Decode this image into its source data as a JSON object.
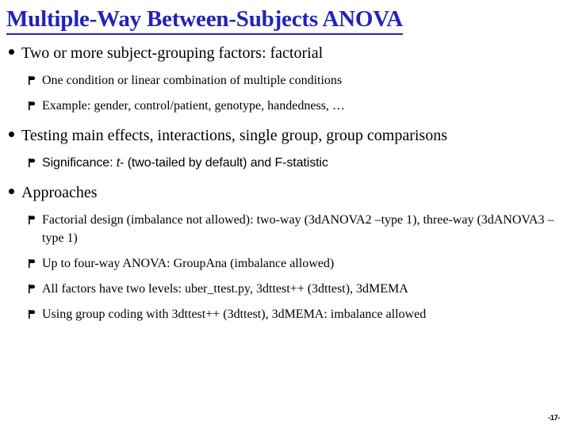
{
  "slide": {
    "title": "Multiple-Way Between-Subjects ANOVA",
    "page_number": "-17-",
    "title_color": "#2222BB",
    "background_color": "#FFFFFF",
    "text_color": "#000000",
    "bullet_markers": {
      "level1": "filled-circle-bullet",
      "level2": "wingdings-pennant-bullet"
    },
    "content": [
      {
        "level": 1,
        "text": "Two or more subject-grouping factors: factorial"
      },
      {
        "level": 2,
        "text": "One condition or linear combination of multiple conditions"
      },
      {
        "level": 2,
        "text": "Example: gender, control/patient, genotype, handedness, …"
      },
      {
        "level": 1,
        "text": "Testing main effects, interactions, single group, group comparisons"
      },
      {
        "level": 2,
        "font": "sans",
        "text_before_italic": "Significance: ",
        "italic_text": "t",
        "text_after_italic": "- (two-tailed by default) and F-statistic",
        "text": "Significance: t- (two-tailed by default) and F-statistic"
      },
      {
        "level": 1,
        "text": "Approaches"
      },
      {
        "level": 2,
        "text": "Factorial design (imbalance not allowed): two-way (3dANOVA2 –type 1), three-way (3dANOVA3 –type 1)"
      },
      {
        "level": 2,
        "text": "Up to four-way ANOVA: GroupAna (imbalance allowed)"
      },
      {
        "level": 2,
        "text": "All factors have two levels: uber_ttest.py, 3dttest++ (3dttest), 3dMEMA"
      },
      {
        "level": 2,
        "text": "Using group coding with 3dttest++ (3dttest), 3dMEMA: imbalance allowed"
      }
    ]
  }
}
